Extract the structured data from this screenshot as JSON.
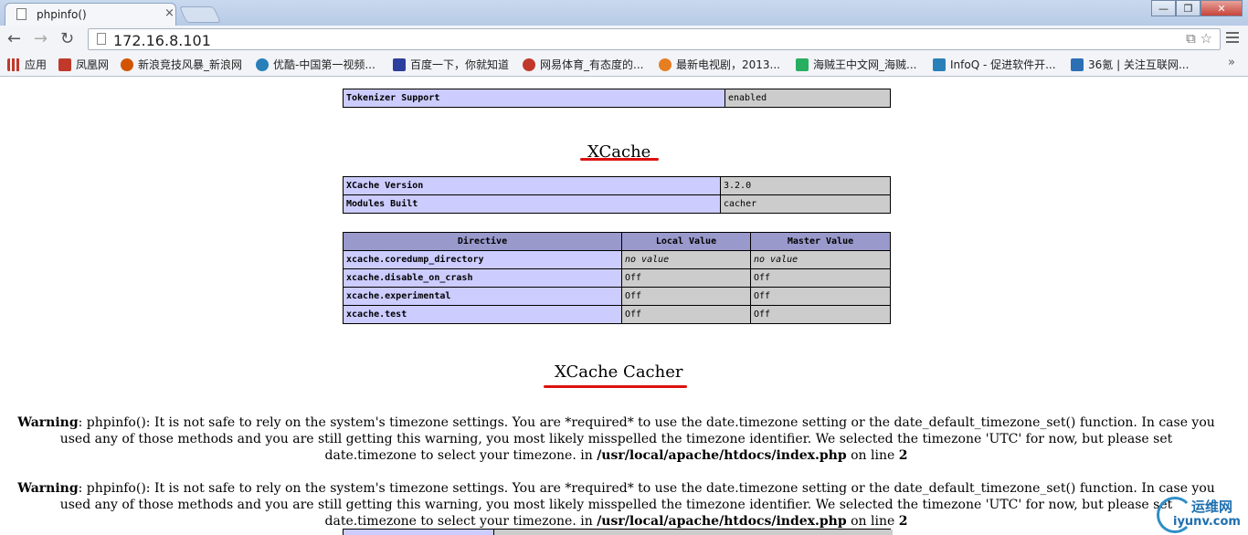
{
  "browser": {
    "tab_title": "phpinfo()",
    "tab_close": "×",
    "address": "172.16.8.101",
    "window_buttons": [
      "—",
      "❐",
      "✕"
    ],
    "bookmarks": [
      {
        "label": "应用",
        "color": "#c0392b"
      },
      {
        "label": "凤凰网",
        "color": "#c0392b"
      },
      {
        "label": "新浪竞技风暴_新浪网",
        "color": "#d35400"
      },
      {
        "label": "优酷-中国第一视频...",
        "color": "#2980b9"
      },
      {
        "label": "百度一下，你就知道",
        "color": "#2c3e9e"
      },
      {
        "label": "网易体育_有态度的...",
        "color": "#c0392b"
      },
      {
        "label": "最新电视剧，2013...",
        "color": "#e67e22"
      },
      {
        "label": "海贼王中文网_海贼...",
        "color": "#27ae60"
      },
      {
        "label": "InfoQ - 促进软件开...",
        "color": "#2980b9"
      },
      {
        "label": "36氪 | 关注互联网...",
        "color": "#2c6fb5"
      }
    ],
    "bookmarks_more": "»"
  },
  "page": {
    "tokenizer": {
      "name": "Tokenizer Support",
      "value": "enabled"
    },
    "xcache_heading": "XCache",
    "xcache_info": [
      {
        "name": "XCache Version",
        "value": "3.2.0"
      },
      {
        "name": "Modules Built",
        "value": "cacher"
      }
    ],
    "directives": {
      "headers": [
        "Directive",
        "Local Value",
        "Master Value"
      ],
      "rows": [
        {
          "name": "xcache.coredump_directory",
          "local": "no value",
          "master": "no value",
          "italic": true
        },
        {
          "name": "xcache.disable_on_crash",
          "local": "Off",
          "master": "Off",
          "italic": false
        },
        {
          "name": "xcache.experimental",
          "local": "Off",
          "master": "Off",
          "italic": false
        },
        {
          "name": "xcache.test",
          "local": "Off",
          "master": "Off",
          "italic": false
        }
      ]
    },
    "cacher_heading": "XCache Cacher",
    "warnings": [
      {
        "label": "Warning",
        "text": ": phpinfo(): It is not safe to rely on the system's timezone settings. You are *required* to use the date.timezone setting or the date_default_timezone_set() function. In case you used any of those methods and you are still getting this warning, you most likely misspelled the timezone identifier. We selected the timezone 'UTC' for now, but please set date.timezone to select your timezone. in ",
        "file": "/usr/local/apache/htdocs/index.php",
        "line_prefix": " on line ",
        "line": "2"
      },
      {
        "label": "Warning",
        "text": ": phpinfo(): It is not safe to rely on the system's timezone settings. You are *required* to use the date.timezone setting or the date_default_timezone_set() function. In case you used any of those methods and you are still getting this warning, you most likely misspelled the timezone identifier. We selected the timezone 'UTC' for now, but please set date.timezone to select your timezone. in ",
        "file": "/usr/local/apache/htdocs/index.php",
        "line_prefix": " on line ",
        "line": "2"
      }
    ]
  },
  "watermark": {
    "name": "运维网",
    "url": "iyunv.com"
  },
  "colors": {
    "accent_underline": "#d11111",
    "header_bg": "#9999cc",
    "name_bg": "#ccccff",
    "value_bg": "#cccccc"
  }
}
